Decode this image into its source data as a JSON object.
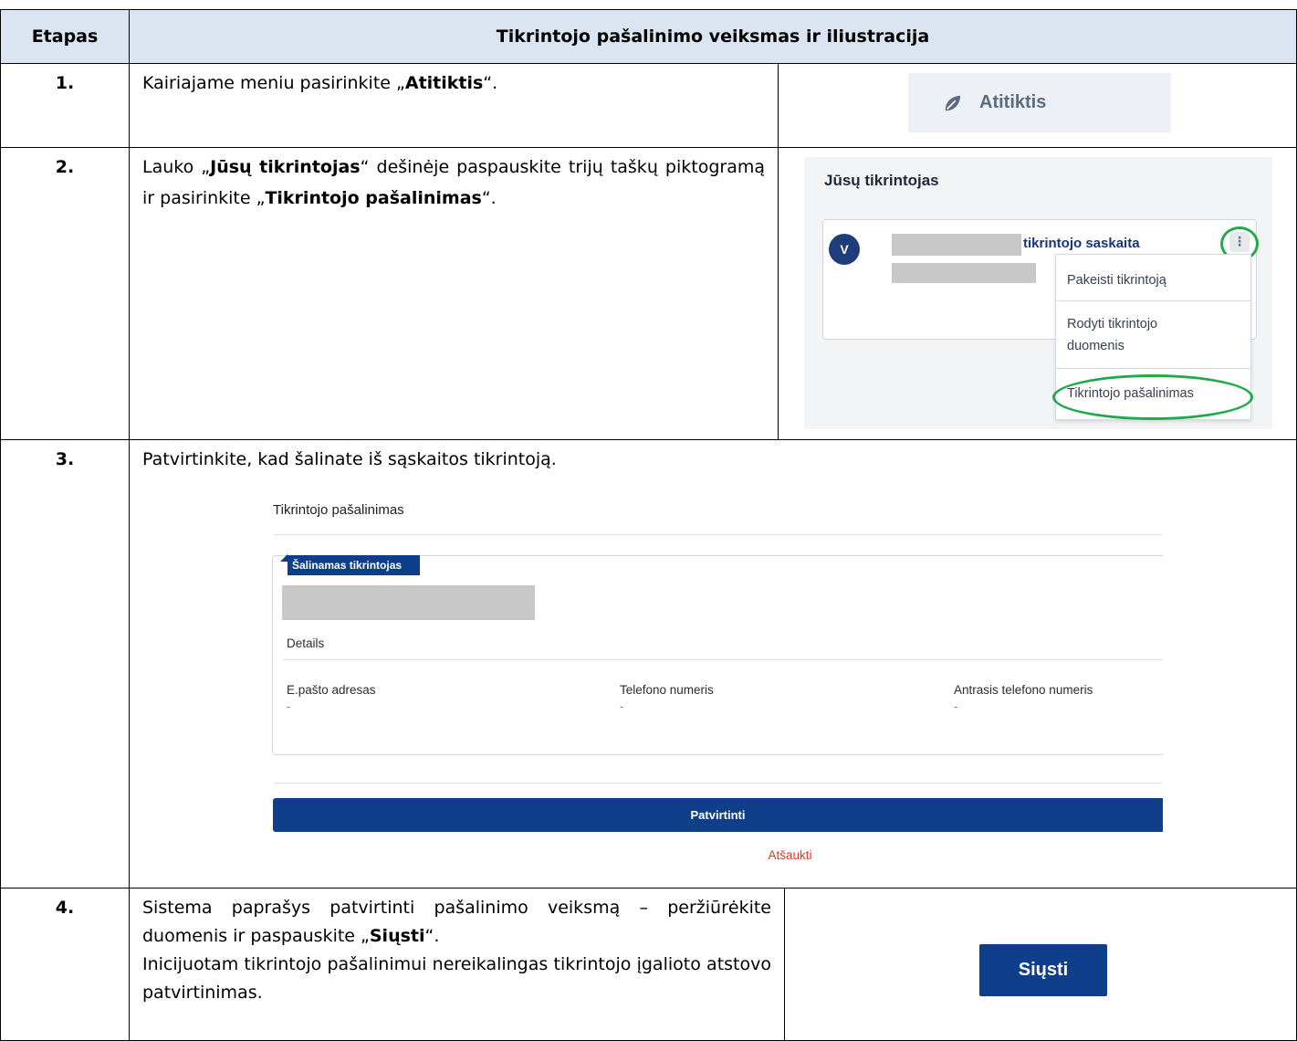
{
  "table": {
    "header": {
      "col1": "Etapas",
      "col2": "Tikrintojo pašalinimo veiksmas ir iliustracija"
    },
    "rows": [
      {
        "num": "1.",
        "text_before": "Kairiajame meniu  pasirinkite „",
        "text_bold": "Atitiktis",
        "text_after": "“."
      },
      {
        "num": "2.",
        "text_1": "Lauko „",
        "text_bold_1": "Jūsų tikrintojas",
        "text_2": "“ dešinėje paspauskite trijų taškų piktogramą ir pasirinkite „",
        "text_bold_2": "Tikrintojo pašalinimas",
        "text_3": "“."
      },
      {
        "num": "3.",
        "text": "Patvirtinkite, kad šalinate iš sąskaitos tikrintoją."
      },
      {
        "num": "4.",
        "text_1": "Sistema paprašys patvirtinti pašalinimo veiksmą – peržiūrėkite duomenis ir paspauskite „",
        "text_bold": "Siųsti",
        "text_2": "“.",
        "text_3": "Inicijuotam tikrintojo pašalinimui nereikalingas tikrintojo įgalioto atstovo patvirtinimas."
      }
    ]
  },
  "illustration_1": {
    "icon": "leaf-icon",
    "label": "Atitiktis"
  },
  "illustration_2": {
    "title": "Jūsų tikrintojas",
    "avatar_letter": "V",
    "account_text": "tikrintojo saskaita",
    "dots": "⋮",
    "menu_items": [
      "Pakeisti tikrintoją",
      "Rodyti tikrintojo duomenis",
      "Tikrintojo pašalinimas"
    ],
    "highlight_color": "#22a94a"
  },
  "illustration_3": {
    "title": "Tikrintojo pašalinimas",
    "tag": "Šalinamas tikrintojas",
    "details_label": "Details",
    "fields": [
      {
        "label": "E.pašto adresas",
        "value": "-"
      },
      {
        "label": "Telefono numeris",
        "value": "-"
      },
      {
        "label": "Antrasis telefono numeris",
        "value": "-"
      }
    ],
    "confirm_label": "Patvirtinti",
    "cancel_label": "Atšaukti"
  },
  "illustration_4": {
    "button_label": "Siųsti"
  },
  "colors": {
    "header_bg": "#dbe5f1",
    "brand_blue": "#0f3e8a",
    "cancel_red": "#d43a2a"
  }
}
